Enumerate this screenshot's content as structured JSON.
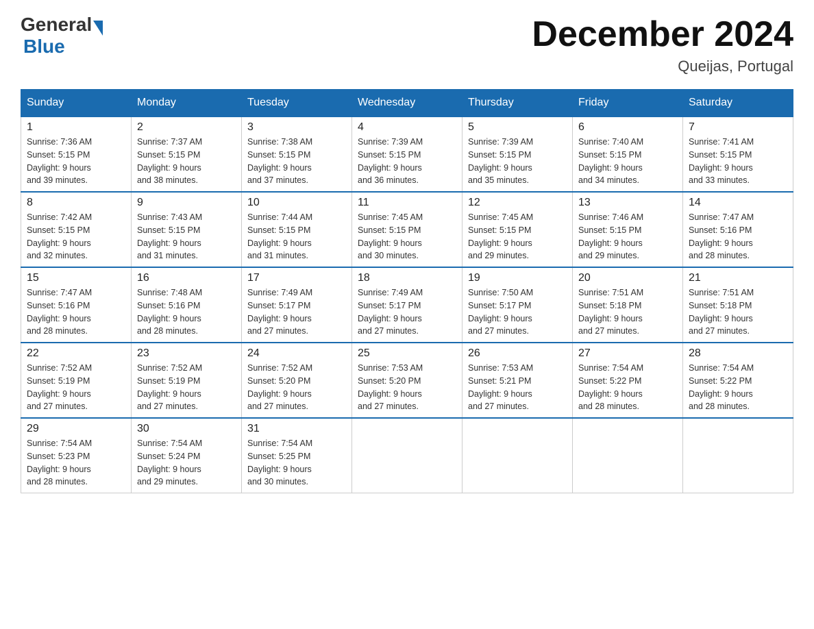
{
  "header": {
    "logo_general": "General",
    "logo_blue": "Blue",
    "month_title": "December 2024",
    "location": "Queijas, Portugal"
  },
  "days_of_week": [
    "Sunday",
    "Monday",
    "Tuesday",
    "Wednesday",
    "Thursday",
    "Friday",
    "Saturday"
  ],
  "weeks": [
    [
      {
        "day": "1",
        "sunrise": "7:36 AM",
        "sunset": "5:15 PM",
        "daylight": "9 hours and 39 minutes."
      },
      {
        "day": "2",
        "sunrise": "7:37 AM",
        "sunset": "5:15 PM",
        "daylight": "9 hours and 38 minutes."
      },
      {
        "day": "3",
        "sunrise": "7:38 AM",
        "sunset": "5:15 PM",
        "daylight": "9 hours and 37 minutes."
      },
      {
        "day": "4",
        "sunrise": "7:39 AM",
        "sunset": "5:15 PM",
        "daylight": "9 hours and 36 minutes."
      },
      {
        "day": "5",
        "sunrise": "7:39 AM",
        "sunset": "5:15 PM",
        "daylight": "9 hours and 35 minutes."
      },
      {
        "day": "6",
        "sunrise": "7:40 AM",
        "sunset": "5:15 PM",
        "daylight": "9 hours and 34 minutes."
      },
      {
        "day": "7",
        "sunrise": "7:41 AM",
        "sunset": "5:15 PM",
        "daylight": "9 hours and 33 minutes."
      }
    ],
    [
      {
        "day": "8",
        "sunrise": "7:42 AM",
        "sunset": "5:15 PM",
        "daylight": "9 hours and 32 minutes."
      },
      {
        "day": "9",
        "sunrise": "7:43 AM",
        "sunset": "5:15 PM",
        "daylight": "9 hours and 31 minutes."
      },
      {
        "day": "10",
        "sunrise": "7:44 AM",
        "sunset": "5:15 PM",
        "daylight": "9 hours and 31 minutes."
      },
      {
        "day": "11",
        "sunrise": "7:45 AM",
        "sunset": "5:15 PM",
        "daylight": "9 hours and 30 minutes."
      },
      {
        "day": "12",
        "sunrise": "7:45 AM",
        "sunset": "5:15 PM",
        "daylight": "9 hours and 29 minutes."
      },
      {
        "day": "13",
        "sunrise": "7:46 AM",
        "sunset": "5:15 PM",
        "daylight": "9 hours and 29 minutes."
      },
      {
        "day": "14",
        "sunrise": "7:47 AM",
        "sunset": "5:16 PM",
        "daylight": "9 hours and 28 minutes."
      }
    ],
    [
      {
        "day": "15",
        "sunrise": "7:47 AM",
        "sunset": "5:16 PM",
        "daylight": "9 hours and 28 minutes."
      },
      {
        "day": "16",
        "sunrise": "7:48 AM",
        "sunset": "5:16 PM",
        "daylight": "9 hours and 28 minutes."
      },
      {
        "day": "17",
        "sunrise": "7:49 AM",
        "sunset": "5:17 PM",
        "daylight": "9 hours and 27 minutes."
      },
      {
        "day": "18",
        "sunrise": "7:49 AM",
        "sunset": "5:17 PM",
        "daylight": "9 hours and 27 minutes."
      },
      {
        "day": "19",
        "sunrise": "7:50 AM",
        "sunset": "5:17 PM",
        "daylight": "9 hours and 27 minutes."
      },
      {
        "day": "20",
        "sunrise": "7:51 AM",
        "sunset": "5:18 PM",
        "daylight": "9 hours and 27 minutes."
      },
      {
        "day": "21",
        "sunrise": "7:51 AM",
        "sunset": "5:18 PM",
        "daylight": "9 hours and 27 minutes."
      }
    ],
    [
      {
        "day": "22",
        "sunrise": "7:52 AM",
        "sunset": "5:19 PM",
        "daylight": "9 hours and 27 minutes."
      },
      {
        "day": "23",
        "sunrise": "7:52 AM",
        "sunset": "5:19 PM",
        "daylight": "9 hours and 27 minutes."
      },
      {
        "day": "24",
        "sunrise": "7:52 AM",
        "sunset": "5:20 PM",
        "daylight": "9 hours and 27 minutes."
      },
      {
        "day": "25",
        "sunrise": "7:53 AM",
        "sunset": "5:20 PM",
        "daylight": "9 hours and 27 minutes."
      },
      {
        "day": "26",
        "sunrise": "7:53 AM",
        "sunset": "5:21 PM",
        "daylight": "9 hours and 27 minutes."
      },
      {
        "day": "27",
        "sunrise": "7:54 AM",
        "sunset": "5:22 PM",
        "daylight": "9 hours and 28 minutes."
      },
      {
        "day": "28",
        "sunrise": "7:54 AM",
        "sunset": "5:22 PM",
        "daylight": "9 hours and 28 minutes."
      }
    ],
    [
      {
        "day": "29",
        "sunrise": "7:54 AM",
        "sunset": "5:23 PM",
        "daylight": "9 hours and 28 minutes."
      },
      {
        "day": "30",
        "sunrise": "7:54 AM",
        "sunset": "5:24 PM",
        "daylight": "9 hours and 29 minutes."
      },
      {
        "day": "31",
        "sunrise": "7:54 AM",
        "sunset": "5:25 PM",
        "daylight": "9 hours and 30 minutes."
      },
      null,
      null,
      null,
      null
    ]
  ],
  "labels": {
    "sunrise": "Sunrise:",
    "sunset": "Sunset:",
    "daylight": "Daylight:"
  }
}
